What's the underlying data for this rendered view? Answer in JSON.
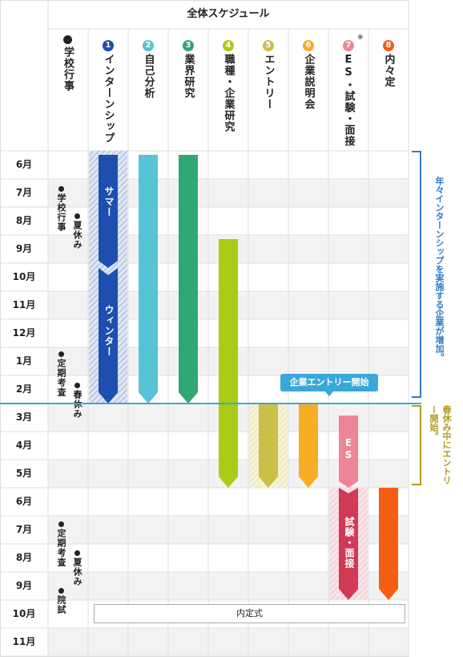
{
  "title": "全体スケジュール",
  "school_header": "学校行事",
  "columns": [
    {
      "num": "1",
      "label": "インターンシップ",
      "color": "#1d4fb0"
    },
    {
      "num": "2",
      "label": "自己分析",
      "color": "#56c3d4"
    },
    {
      "num": "3",
      "label": "業界研究",
      "color": "#2fa872"
    },
    {
      "num": "4",
      "label": "職種・企業研究",
      "color": "#a8cc16"
    },
    {
      "num": "5",
      "label": "エントリー",
      "color": "#ccbf48"
    },
    {
      "num": "6",
      "label": "企業説明会",
      "color": "#f7ad24"
    },
    {
      "num": "7",
      "label": "ES・試験・面接",
      "color": "#ee8596",
      "note": "※"
    },
    {
      "num": "8",
      "label": "内々定",
      "color": "#f35e12"
    }
  ],
  "months": [
    "6月",
    "7月",
    "8月",
    "9月",
    "10月",
    "11月",
    "12月",
    "1月",
    "2月",
    "3月",
    "4月",
    "5月",
    "6月",
    "7月",
    "8月",
    "9月",
    "10月",
    "11月"
  ],
  "school_events": {
    "y1_events": "学校行事",
    "y1_summer": "夏休み",
    "y1_exam": "定期考査",
    "y1_spring": "春休み",
    "y2_exam": "定期考査",
    "y2_summer": "夏休み",
    "y2_grad": "院試"
  },
  "bars": {
    "summer": "サマー",
    "winter": "ウィンター",
    "es": "ES",
    "interview": "試験・面接"
  },
  "callout": "企業エントリー開始",
  "naitei_ceremony": "内定式",
  "side_notes": {
    "upper": "年々インターンシップを実施する企業が増加。",
    "lower": "春休み中にエントリー開始。"
  },
  "colors": {
    "grid": "#dddddd",
    "stripe": "#f2f2f2",
    "line_blue": "#3aa7d9",
    "bracket_blue": "#2f7cc4",
    "bracket_gold": "#b29a22",
    "callout_bg": "#3aa7d9"
  }
}
